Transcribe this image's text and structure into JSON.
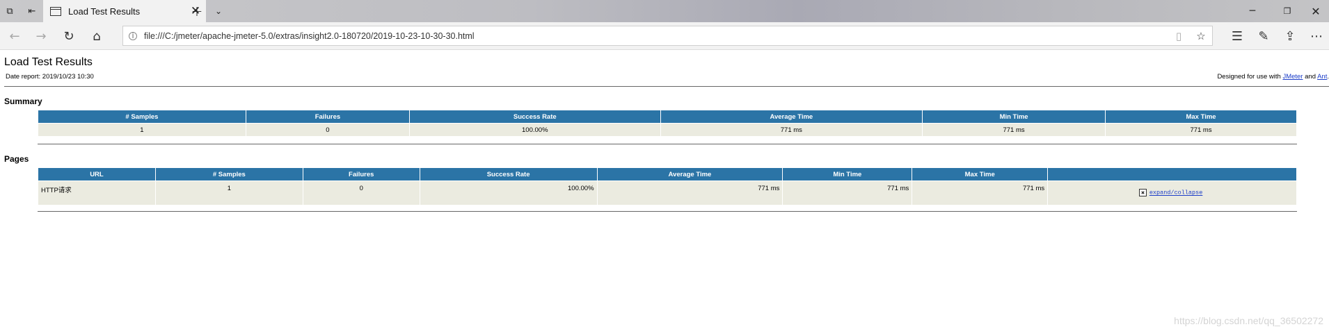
{
  "browser": {
    "tab_title": "Load Test Results",
    "url": "file:///C:/jmeter/apache-jmeter-5.0/extras/insight2.0-180720/2019-10-23-10-30-30.html"
  },
  "page": {
    "title": "Load Test Results",
    "date_report": "Date report: 2019/10/23 10:30",
    "designed_prefix": "Designed for use with ",
    "designed_link1": "JMeter",
    "designed_and": " and ",
    "designed_link2": "Ant",
    "designed_suffix": "."
  },
  "summary": {
    "heading": "Summary",
    "columns": [
      "# Samples",
      "Failures",
      "Success Rate",
      "Average Time",
      "Min Time",
      "Max Time"
    ],
    "row": [
      "1",
      "0",
      "100.00%",
      "771 ms",
      "771 ms",
      "771 ms"
    ]
  },
  "pages": {
    "heading": "Pages",
    "columns": [
      "URL",
      "# Samples",
      "Failures",
      "Success Rate",
      "Average Time",
      "Min Time",
      "Max Time",
      ""
    ],
    "row": [
      "HTTP请求",
      "1",
      "0",
      "100.00%",
      "771 ms",
      "771 ms",
      "771 ms"
    ],
    "expand_label": "expand/collapse"
  },
  "watermark": "https://blog.csdn.net/qq_36502272"
}
